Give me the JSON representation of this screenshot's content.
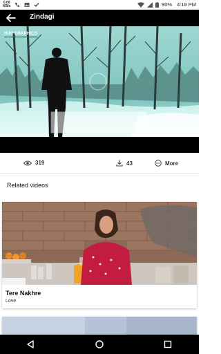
{
  "status_bar": {
    "speed_value": "0.00",
    "speed_unit": "KB/s",
    "battery": "90%",
    "time": "4:18 PM"
  },
  "player": {
    "title": "Zindagi",
    "logo_text": "HIHI GRAPHICS"
  },
  "stats": {
    "views": "319",
    "downloads": "43",
    "more_label": "More"
  },
  "related": {
    "heading": "Related videos",
    "items": [
      {
        "title": "Tere Nakhre",
        "subtitle": "Love"
      }
    ]
  },
  "colors": {
    "player_bg": "#000000",
    "accent_red": "#cc0000",
    "divider": "#e3e3e3"
  }
}
